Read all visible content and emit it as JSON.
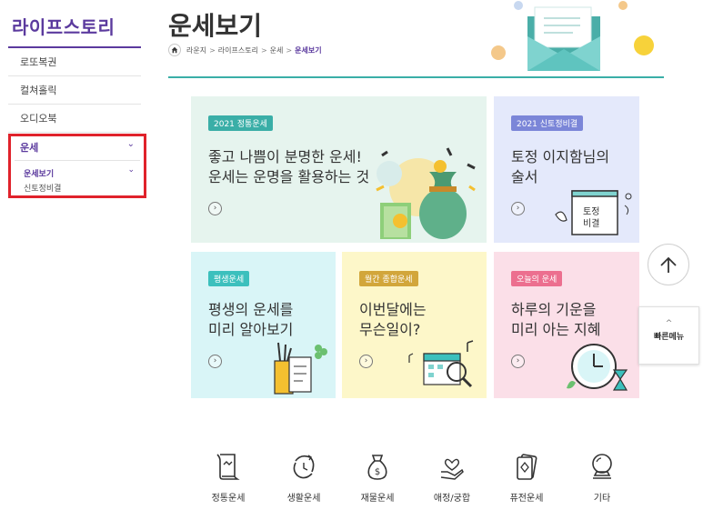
{
  "sidebar": {
    "brand": "라이프스토리",
    "items": [
      {
        "label": "로또복권"
      },
      {
        "label": "컬쳐홀릭"
      },
      {
        "label": "오디오북"
      }
    ],
    "active": {
      "label": "운세",
      "sub": [
        {
          "label": "운세보기"
        },
        {
          "label": "신토정비결"
        }
      ]
    }
  },
  "header": {
    "title": "운세보기",
    "breadcrumb": [
      "라운지",
      "라이프스토리",
      "운세",
      "운세보기"
    ]
  },
  "cards": [
    {
      "tag": "2021 정통운세",
      "line1": "좋고 나쁨이 분명한 운세!",
      "line2": "운세는 운명을 활용하는 것"
    },
    {
      "tag": "2021 신토정비결",
      "line1": "토정 이지함님의",
      "line2": "술서",
      "badge1": "토정",
      "badge2": "비결"
    },
    {
      "tag": "평생운세",
      "line1": "평생의 운세를",
      "line2": "미리 알아보기"
    },
    {
      "tag": "월간 종합운세",
      "line1": "이번달에는",
      "line2": "무슨일이?"
    },
    {
      "tag": "오늘의 운세",
      "line1": "하루의 기운을",
      "line2": "미리 아는 지혜"
    }
  ],
  "floating": {
    "quick_menu": "빠른메뉴"
  },
  "categories": [
    {
      "label": "정통운세",
      "icon": "scroll-icon"
    },
    {
      "label": "생활운세",
      "icon": "cycle-icon"
    },
    {
      "label": "재물운세",
      "icon": "money-bag-icon"
    },
    {
      "label": "애정/궁합",
      "icon": "heart-hand-icon"
    },
    {
      "label": "퓨전운세",
      "icon": "cards-icon"
    },
    {
      "label": "기타",
      "icon": "crystal-ball-icon"
    }
  ],
  "colors": {
    "brand": "#5b3a9e",
    "accent": "#3aaea7",
    "highlight": "#e0222b"
  }
}
